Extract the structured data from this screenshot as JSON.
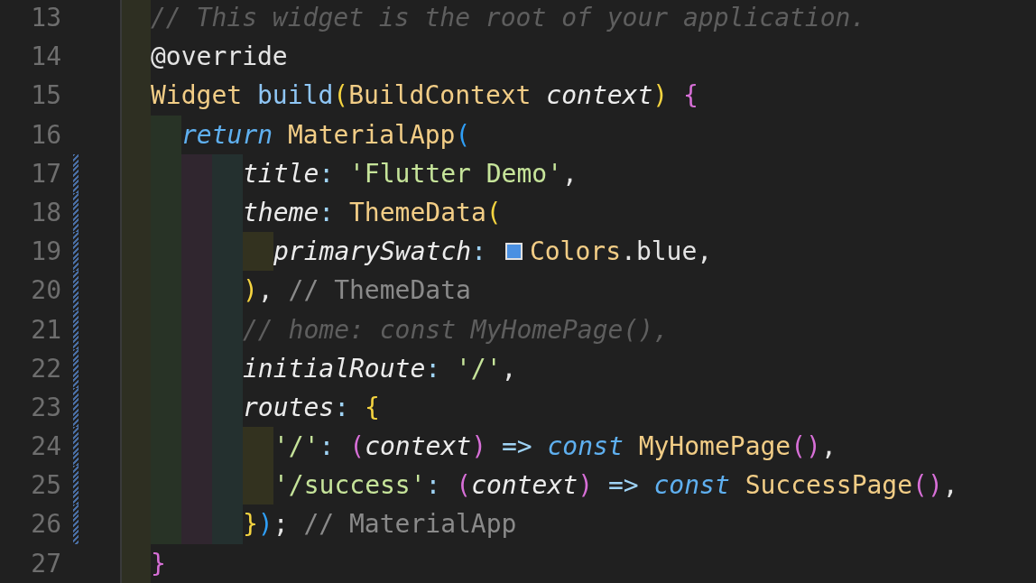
{
  "editor": {
    "lines": [
      {
        "number": "13",
        "modified": false,
        "guides": [
          {
            "color": "#2e2f22"
          }
        ],
        "tokens": [
          {
            "kind": "cm",
            "text": "// This widget is the root of your application."
          }
        ]
      },
      {
        "number": "14",
        "modified": false,
        "guides": [
          {
            "color": "#2e2f22"
          }
        ],
        "tokens": [
          {
            "kind": "dec",
            "text": "@override"
          }
        ]
      },
      {
        "number": "15",
        "modified": false,
        "guides": [
          {
            "color": "#2e2f22"
          }
        ],
        "tokens": [
          {
            "kind": "ty",
            "text": "Widget "
          },
          {
            "kind": "fn",
            "text": "build"
          },
          {
            "kind": "b1",
            "text": "("
          },
          {
            "kind": "ty",
            "text": "BuildContext "
          },
          {
            "kind": "prm",
            "text": "context"
          },
          {
            "kind": "b1",
            "text": ") "
          },
          {
            "kind": "b2",
            "text": "{"
          }
        ]
      },
      {
        "number": "16",
        "modified": false,
        "guides": [
          {
            "color": "#2e2f22"
          },
          {
            "color": "#283326"
          }
        ],
        "tokens": [
          {
            "kind": "kw",
            "text": "return "
          },
          {
            "kind": "ty",
            "text": "MaterialApp"
          },
          {
            "kind": "b3",
            "text": "("
          }
        ]
      },
      {
        "number": "17",
        "modified": true,
        "guides": [
          {
            "color": "#2e2f22"
          },
          {
            "color": "#283326"
          },
          {
            "color": "#30262f"
          },
          {
            "color": "#24302f"
          }
        ],
        "tokens": [
          {
            "kind": "prm",
            "text": "title"
          },
          {
            "kind": "op",
            "text": ": "
          },
          {
            "kind": "str",
            "text": "'Flutter Demo'"
          },
          {
            "kind": "p",
            "text": ","
          }
        ]
      },
      {
        "number": "18",
        "modified": true,
        "guides": [
          {
            "color": "#2e2f22"
          },
          {
            "color": "#283326"
          },
          {
            "color": "#30262f"
          },
          {
            "color": "#24302f"
          }
        ],
        "tokens": [
          {
            "kind": "prm",
            "text": "theme"
          },
          {
            "kind": "op",
            "text": ": "
          },
          {
            "kind": "ty",
            "text": "ThemeData"
          },
          {
            "kind": "b1",
            "text": "("
          }
        ]
      },
      {
        "number": "19",
        "modified": true,
        "guides": [
          {
            "color": "#2e2f22"
          },
          {
            "color": "#283326"
          },
          {
            "color": "#30262f"
          },
          {
            "color": "#24302f"
          },
          {
            "color": "#33321f"
          }
        ],
        "tokens": [
          {
            "kind": "prm",
            "text": "primarySwatch"
          },
          {
            "kind": "op",
            "text": ": "
          },
          {
            "kind": "swatch",
            "color": "#4a90e2"
          },
          {
            "kind": "ty",
            "text": "Colors"
          },
          {
            "kind": "p",
            "text": ".blue,"
          }
        ]
      },
      {
        "number": "20",
        "modified": true,
        "guides": [
          {
            "color": "#2e2f22"
          },
          {
            "color": "#283326"
          },
          {
            "color": "#30262f"
          },
          {
            "color": "#24302f"
          }
        ],
        "tokens": [
          {
            "kind": "b1",
            "text": ")"
          },
          {
            "kind": "p",
            "text": ", "
          },
          {
            "kind": "lbl",
            "text": "// ThemeData"
          }
        ]
      },
      {
        "number": "21",
        "modified": true,
        "guides": [
          {
            "color": "#2e2f22"
          },
          {
            "color": "#283326"
          },
          {
            "color": "#30262f"
          },
          {
            "color": "#24302f"
          }
        ],
        "tokens": [
          {
            "kind": "cm",
            "text": "// home: const MyHomePage(),"
          }
        ]
      },
      {
        "number": "22",
        "modified": true,
        "guides": [
          {
            "color": "#2e2f22"
          },
          {
            "color": "#283326"
          },
          {
            "color": "#30262f"
          },
          {
            "color": "#24302f"
          }
        ],
        "tokens": [
          {
            "kind": "prm",
            "text": "initialRoute"
          },
          {
            "kind": "op",
            "text": ": "
          },
          {
            "kind": "str",
            "text": "'/'"
          },
          {
            "kind": "p",
            "text": ","
          }
        ]
      },
      {
        "number": "23",
        "modified": true,
        "guides": [
          {
            "color": "#2e2f22"
          },
          {
            "color": "#283326"
          },
          {
            "color": "#30262f"
          },
          {
            "color": "#24302f"
          }
        ],
        "tokens": [
          {
            "kind": "prm",
            "text": "routes"
          },
          {
            "kind": "op",
            "text": ": "
          },
          {
            "kind": "b1",
            "text": "{"
          }
        ]
      },
      {
        "number": "24",
        "modified": true,
        "guides": [
          {
            "color": "#2e2f22"
          },
          {
            "color": "#283326"
          },
          {
            "color": "#30262f"
          },
          {
            "color": "#24302f"
          },
          {
            "color": "#33321f"
          }
        ],
        "tokens": [
          {
            "kind": "str",
            "text": "'/'"
          },
          {
            "kind": "op",
            "text": ": "
          },
          {
            "kind": "b2",
            "text": "("
          },
          {
            "kind": "prm",
            "text": "context"
          },
          {
            "kind": "b2",
            "text": ")"
          },
          {
            "kind": "op",
            "text": " => "
          },
          {
            "kind": "kw",
            "text": "const "
          },
          {
            "kind": "ty",
            "text": "MyHomePage"
          },
          {
            "kind": "b2",
            "text": "()"
          },
          {
            "kind": "p",
            "text": ","
          }
        ]
      },
      {
        "number": "25",
        "modified": true,
        "guides": [
          {
            "color": "#2e2f22"
          },
          {
            "color": "#283326"
          },
          {
            "color": "#30262f"
          },
          {
            "color": "#24302f"
          },
          {
            "color": "#33321f"
          }
        ],
        "tokens": [
          {
            "kind": "str",
            "text": "'/success'"
          },
          {
            "kind": "op",
            "text": ": "
          },
          {
            "kind": "b2",
            "text": "("
          },
          {
            "kind": "prm",
            "text": "context"
          },
          {
            "kind": "b2",
            "text": ")"
          },
          {
            "kind": "op",
            "text": " => "
          },
          {
            "kind": "kw",
            "text": "const "
          },
          {
            "kind": "ty",
            "text": "SuccessPage"
          },
          {
            "kind": "b2",
            "text": "()"
          },
          {
            "kind": "p",
            "text": ","
          }
        ]
      },
      {
        "number": "26",
        "modified": true,
        "guides": [
          {
            "color": "#2e2f22"
          },
          {
            "color": "#283326"
          },
          {
            "color": "#30262f"
          },
          {
            "color": "#24302f"
          }
        ],
        "tokens": [
          {
            "kind": "b1",
            "text": "}"
          },
          {
            "kind": "b3",
            "text": ")"
          },
          {
            "kind": "p",
            "text": "; "
          },
          {
            "kind": "lbl",
            "text": "// MaterialApp"
          }
        ]
      },
      {
        "number": "27",
        "modified": false,
        "guides": [
          {
            "color": "#2e2f22"
          }
        ],
        "tokens": [
          {
            "kind": "b2",
            "text": "}"
          }
        ]
      }
    ]
  }
}
